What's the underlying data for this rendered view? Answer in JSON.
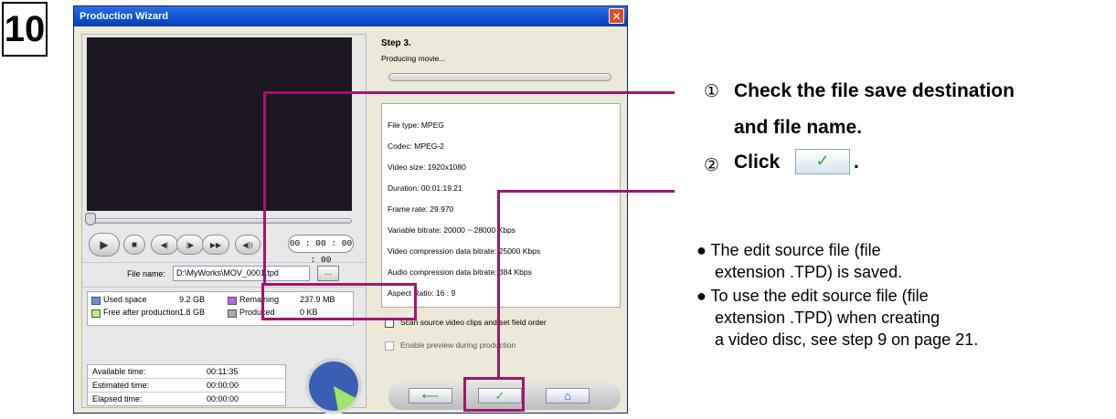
{
  "step_number": "10",
  "window": {
    "title": "Production Wizard",
    "close_glyph": "✕"
  },
  "player": {
    "play_icon": "▶",
    "stop_icon": "■",
    "prev_icon": "◀|",
    "next_icon": "|▶",
    "ffwd_icon": "▶▶",
    "volume_icon": "◀))",
    "timecode": "00 : 00 : 00 : 00"
  },
  "file": {
    "label": "File name:",
    "value": "D:\\MyWorks\\MOV_0001.tpd",
    "browse_label": "..."
  },
  "space": {
    "used_label": "Used space",
    "used_value": "9.2  GB",
    "remaining_label": "Remaining",
    "remaining_value": "237.9  MB",
    "free_label": "Free after production",
    "free_value": "1.8  GB",
    "produced_label": "Produced",
    "produced_value": "0 KB",
    "colors": {
      "used": "#6a8fe0",
      "remaining": "#b36ad6",
      "free": "#b8f07a",
      "produced": "#a9a9a9"
    }
  },
  "times": [
    {
      "label": "Available time:",
      "value": "00:11:35"
    },
    {
      "label": "Estimated time:",
      "value": "00:00:00"
    },
    {
      "label": "Elapsed time:",
      "value": "00:00:00"
    }
  ],
  "wizard": {
    "step_title": "Step 3.",
    "status": "Producing movie..."
  },
  "info_lines": [
    "File type: MPEG",
    "Codec: MPEG-2",
    "Video size: 1920x1080",
    "Duration: 00:01:19.21",
    "Frame rate: 29.970",
    "Variable bitrate: 20000 ~ 28000 Kbps",
    "Video compression data bitrate: 25000 Kbps",
    "Audio compression data bitrate: 384 Kbps",
    "Aspect Ratio: 16 : 9"
  ],
  "options": {
    "scan_label": "Scan source video clips and set field order",
    "preview_label": "Enable preview during production"
  },
  "nav": {
    "back_icon": "⟵",
    "ok_icon": "✓",
    "home_icon": "⌂"
  },
  "instructions": {
    "one_num": "①",
    "one_line1": "Check the file save destination",
    "one_line2": "and file name.",
    "two_num": "②",
    "two_text": "Click",
    "two_period": ".",
    "click_sample_icon": "✓",
    "bullet1_line1": "● The edit source file (file",
    "bullet1_line2": "extension .TPD) is saved.",
    "bullet2_line1": "● To use the edit source file (file",
    "bullet2_line2": "extension .TPD) when creating",
    "bullet2_line3": "a video disc, see step 9 on page 21."
  }
}
